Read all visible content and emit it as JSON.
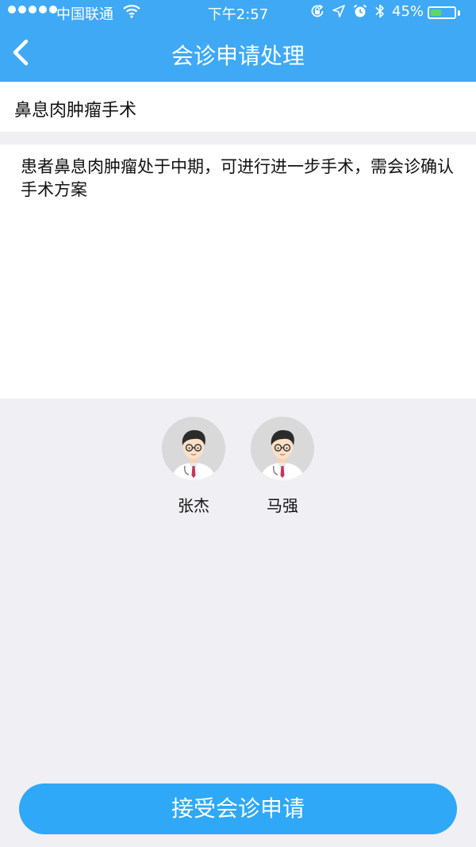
{
  "status_bar": {
    "carrier": "中国联通",
    "time": "下午2:57",
    "battery_percent": "45%",
    "battery_level": 0.45,
    "icons": [
      "signal-dots-icon",
      "wifi-icon",
      "orientation-lock-icon",
      "location-arrow-icon",
      "alarm-icon",
      "bluetooth-icon",
      "battery-icon"
    ]
  },
  "nav": {
    "title": "会诊申请处理",
    "back_icon": "chevron-left-icon"
  },
  "request": {
    "title": "鼻息肉肿瘤手术",
    "description": "患者鼻息肉肿瘤处于中期，可进行进一步手术，需会诊确认手术方案"
  },
  "participants": [
    {
      "name": "张杰",
      "avatar_icon": "doctor-avatar-icon"
    },
    {
      "name": "马强",
      "avatar_icon": "doctor-avatar-icon"
    }
  ],
  "actions": {
    "accept_label": "接受会诊申请"
  },
  "colors": {
    "header": "#3fa9f5",
    "accept_button": "#2ea8f7",
    "background": "#efeff4",
    "battery_fill": "#5fd85f"
  }
}
